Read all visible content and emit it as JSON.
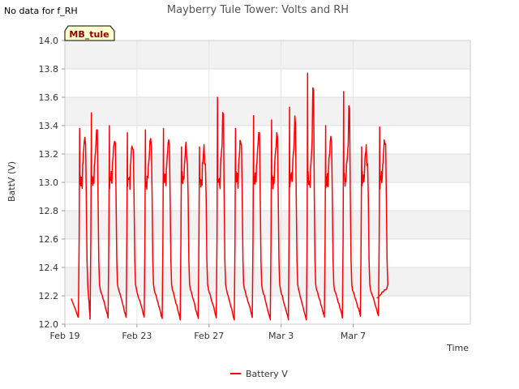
{
  "note": "No data for f_RH",
  "chart_data": {
    "type": "line",
    "title": "Mayberry Tule Tower: Volts and RH",
    "xlabel": "Time",
    "ylabel": "BattV (V)",
    "ylim": [
      12.0,
      14.0
    ],
    "yticks": [
      "12.0",
      "12.2",
      "12.4",
      "12.6",
      "12.8",
      "13.0",
      "13.2",
      "13.4",
      "13.6",
      "13.8",
      "14.0"
    ],
    "xlim_days": [
      0,
      22.5
    ],
    "xticks": [
      {
        "day": 0,
        "label": "Feb 19"
      },
      {
        "day": 4,
        "label": "Feb 23"
      },
      {
        "day": 8,
        "label": "Feb 27"
      },
      {
        "day": 12,
        "label": "Mar 3"
      },
      {
        "day": 16,
        "label": "Mar 7"
      }
    ],
    "grid": true,
    "badge": "MB_tule",
    "legend": {
      "position": "bottom",
      "label": "Battery V",
      "color": "#ff0000"
    },
    "series": [
      {
        "name": "Battery V",
        "color": "#ff0000",
        "days": [
          {
            "start": 0.35,
            "min": 12.05,
            "peak": 13.38
          },
          {
            "start": 1.0,
            "min": 12.04,
            "peak": 13.49
          },
          {
            "start": 2.0,
            "min": 12.05,
            "peak": 13.4
          },
          {
            "start": 3.0,
            "min": 12.05,
            "peak": 13.35
          },
          {
            "start": 4.0,
            "min": 12.05,
            "peak": 13.37
          },
          {
            "start": 5.0,
            "min": 12.04,
            "peak": 13.38
          },
          {
            "start": 6.0,
            "min": 12.03,
            "peak": 13.25
          },
          {
            "start": 7.0,
            "min": 12.04,
            "peak": 13.25
          },
          {
            "start": 8.0,
            "min": 12.05,
            "peak": 13.6
          },
          {
            "start": 9.0,
            "min": 12.03,
            "peak": 13.38
          },
          {
            "start": 10.0,
            "min": 12.05,
            "peak": 13.47
          },
          {
            "start": 11.0,
            "min": 12.03,
            "peak": 13.44
          },
          {
            "start": 12.0,
            "min": 12.03,
            "peak": 13.53
          },
          {
            "start": 13.0,
            "min": 12.03,
            "peak": 13.77
          },
          {
            "start": 14.0,
            "min": 12.05,
            "peak": 13.4
          },
          {
            "start": 15.0,
            "min": 12.05,
            "peak": 13.64
          },
          {
            "start": 16.0,
            "min": 12.06,
            "peak": 13.25
          },
          {
            "start": 17.0,
            "min": 12.06,
            "peak": 13.39
          }
        ],
        "end_day": 17.3,
        "end_value": 12.18
      }
    ]
  }
}
